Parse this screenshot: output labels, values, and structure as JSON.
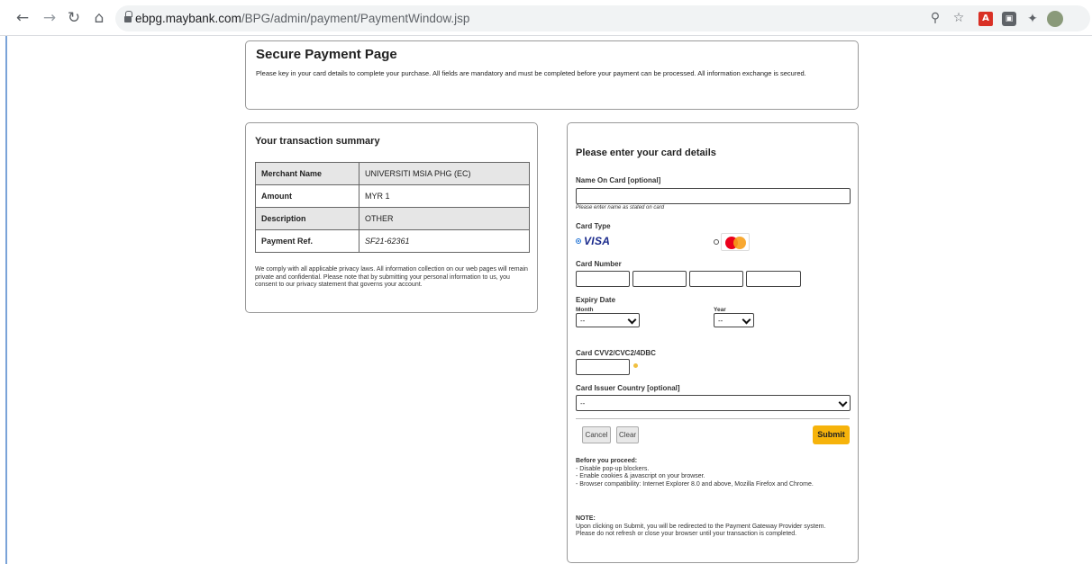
{
  "browser": {
    "url_domain": "ebpg.maybank.com",
    "url_path": "/BPG/admin/payment/PaymentWindow.jsp"
  },
  "header": {
    "title": "Secure Payment Page",
    "description": "Please key in your card details to complete your purchase. All fields are mandatory and must be completed before your payment can be processed. All information exchange is secured."
  },
  "summary": {
    "title": "Your transaction summary",
    "rows": [
      {
        "label": "Merchant Name",
        "value": "UNIVERSITI MSIA PHG (EC)"
      },
      {
        "label": "Amount",
        "value": "MYR 1"
      },
      {
        "label": "Description",
        "value": "OTHER"
      },
      {
        "label": "Payment Ref.",
        "value": "SF21-62361"
      }
    ],
    "privacy": "We comply with all applicable privacy laws. All information collection on our web pages will remain private and confidential. Please note that by submitting your personal information to us, you consent to our privacy statement that governs your account."
  },
  "card": {
    "title": "Please enter your card details",
    "name_label": "Name On Card [optional]",
    "name_value": "",
    "name_hint": "Please enter name as stated on card",
    "type_label": "Card Type",
    "visa_text": "VISA",
    "number_label": "Card Number",
    "expiry_label": "Expiry Date",
    "month_label": "Month",
    "month_value": "--",
    "year_label": "Year",
    "year_value": "--",
    "cvv_label": "Card CVV2/CVC2/4DBC",
    "country_label": "Card Issuer Country [optional]",
    "country_value": "--",
    "cancel": "Cancel",
    "clear": "Clear",
    "submit": "Submit",
    "proceed_title": "Before you proceed:",
    "proceed_items": [
      "- Disable pop-up blockers.",
      "- Enable cookies & javascript on your browser.",
      "- Browser compatibility: Internet Explorer 8.0 and above, Mozilla Firefox and Chrome."
    ],
    "note_title": "NOTE:",
    "note_text": "Upon clicking on Submit, you will be redirected to the Payment Gateway Provider system. Please do not refresh or close your browser until your transaction is completed."
  },
  "colors": {
    "submit_bg": "#f6b30b",
    "table_shade": "#e6e6e6",
    "visa_blue": "#1a2a8c"
  }
}
